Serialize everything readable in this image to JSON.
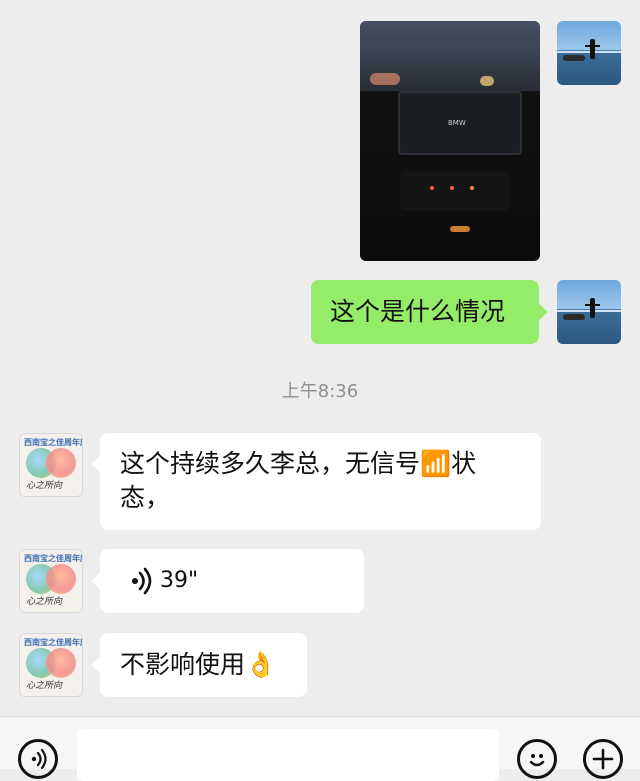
{
  "messages": {
    "sent_text": "这个是什么情况",
    "timestamp": "上午8:36",
    "received_1": "这个持续多久李总，无信号📶状态，",
    "voice_duration": "39\"",
    "received_3": "不影响使用👌"
  },
  "photo": {
    "screen_brand": "BMW"
  },
  "contact_avatar": {
    "top_text": "西南宝之佳周年庆",
    "script_text": "心之所向"
  },
  "icons": {
    "voice_wave": "voice-wave-icon",
    "voice_toggle": "voice-toggle-icon",
    "emoji": "emoji-icon",
    "add": "plus-icon"
  },
  "colors": {
    "background": "#ededed",
    "sent_bubble": "#95ec69",
    "received_bubble": "#ffffff"
  }
}
